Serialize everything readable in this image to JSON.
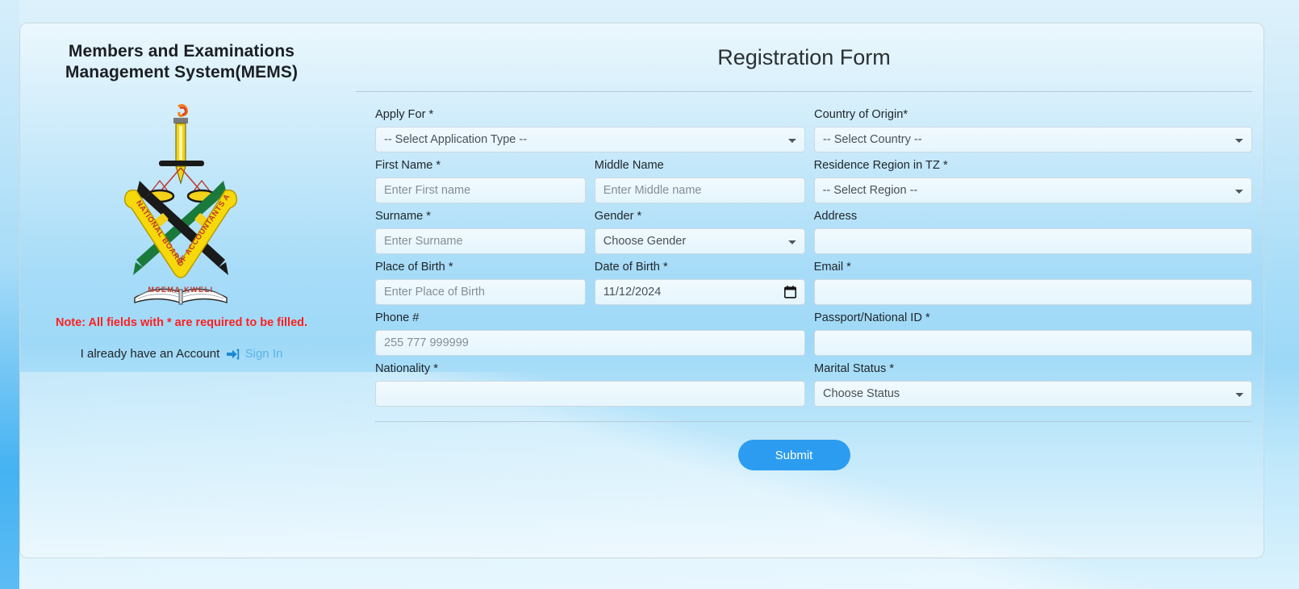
{
  "brand": {
    "title_line1": "Members and Examinations",
    "title_line2": "Management System(MEMS)",
    "logo_alt": "nbaa-logo",
    "logo_ring_text": "NATIONAL BOARD OF ACCOUNTANTS AND AUDITORS",
    "logo_motto": "MSEMA KWELI",
    "note": "Note: All fields with * are required to be filled.",
    "account_text": "I already have an Account",
    "signin_label": "Sign In",
    "signin_icon": "sign-in-arrow-icon"
  },
  "form": {
    "title": "Registration Form",
    "fields": {
      "apply_for": {
        "label": "Apply For *",
        "value": "-- Select Application Type --"
      },
      "country_of_origin": {
        "label": "Country of Origin*",
        "value": "-- Select Country --"
      },
      "first_name": {
        "label": "First Name *",
        "value": "",
        "placeholder": "Enter First name"
      },
      "middle_name": {
        "label": "Middle Name",
        "value": "",
        "placeholder": "Enter Middle name"
      },
      "residence_region": {
        "label": "Residence Region in TZ *",
        "value": "-- Select Region --"
      },
      "surname": {
        "label": "Surname *",
        "value": "",
        "placeholder": "Enter Surname"
      },
      "gender": {
        "label": "Gender *",
        "value": "Choose Gender"
      },
      "address": {
        "label": "Address",
        "value": "",
        "placeholder": ""
      },
      "place_of_birth": {
        "label": "Place of Birth *",
        "value": "",
        "placeholder": "Enter Place of Birth"
      },
      "date_of_birth": {
        "label": "Date of Birth *",
        "value": "11/12/2024",
        "icon": "calendar-icon"
      },
      "email": {
        "label": "Email *",
        "value": "",
        "placeholder": ""
      },
      "phone": {
        "label": "Phone #",
        "value": "",
        "placeholder": "255 777 999999"
      },
      "passport_national_id": {
        "label": "Passport/National ID *",
        "value": "",
        "placeholder": ""
      },
      "nationality": {
        "label": "Nationality *",
        "value": "",
        "placeholder": ""
      },
      "marital_status": {
        "label": "Marital Status *",
        "value": "Choose Status"
      }
    },
    "submit_label": "Submit"
  },
  "colors": {
    "accent": "#2c9cf0",
    "note_red": "#ff1f1f",
    "link_blue": "#5bb3e8",
    "card_bg_top": "#eaf7fd",
    "card_bg_mid": "#a7dcf8"
  }
}
